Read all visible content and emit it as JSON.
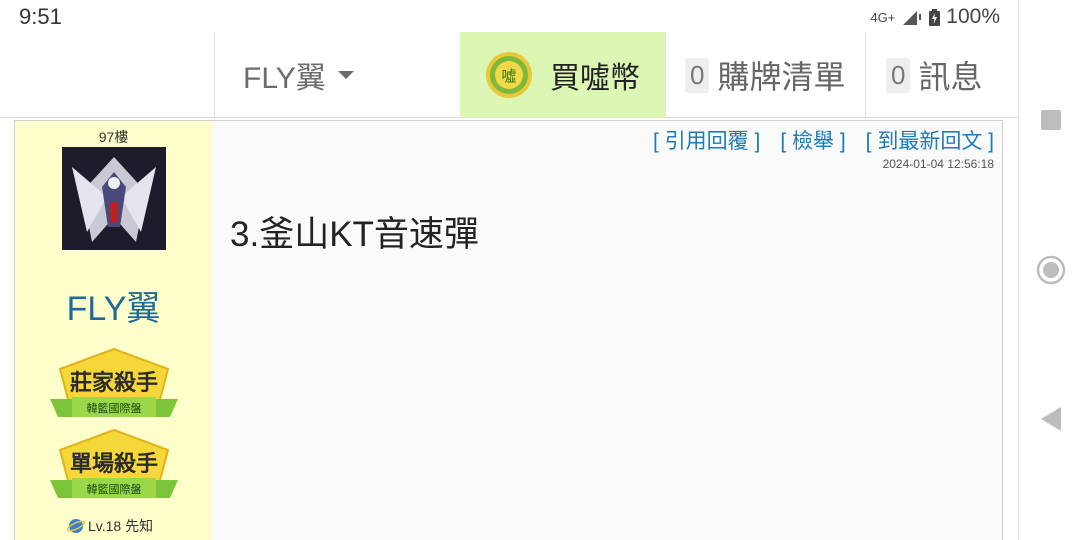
{
  "status_bar": {
    "time": "9:51",
    "network": "4G+",
    "battery": "100%"
  },
  "header": {
    "user_name": "FLY翼",
    "buy_coins_label": "買噓幣",
    "cart": {
      "count": "0",
      "label": "購牌清單"
    },
    "messages": {
      "count": "0",
      "label": "訊息"
    }
  },
  "post": {
    "floor": "97樓",
    "author_name": "FLY翼",
    "awards": [
      {
        "title": "莊家殺手",
        "subtitle": "韓籃國際盤"
      },
      {
        "title": "單場殺手",
        "subtitle": "韓籃國際盤"
      }
    ],
    "level": "Lv.18 先知",
    "actions": {
      "quote_reply": "[ 引用回覆 ]",
      "report": "[ 檢舉 ]",
      "latest_reply": "[ 到最新回文 ]"
    },
    "timestamp": "2024-01-04 12:56:18",
    "content": "3.釜山KT音速彈"
  },
  "colors": {
    "author_bg": "#ffffcc",
    "buy_bg": "#dcf6b4",
    "link": "#1f7bb5",
    "author_name": "#1d6a9a"
  }
}
